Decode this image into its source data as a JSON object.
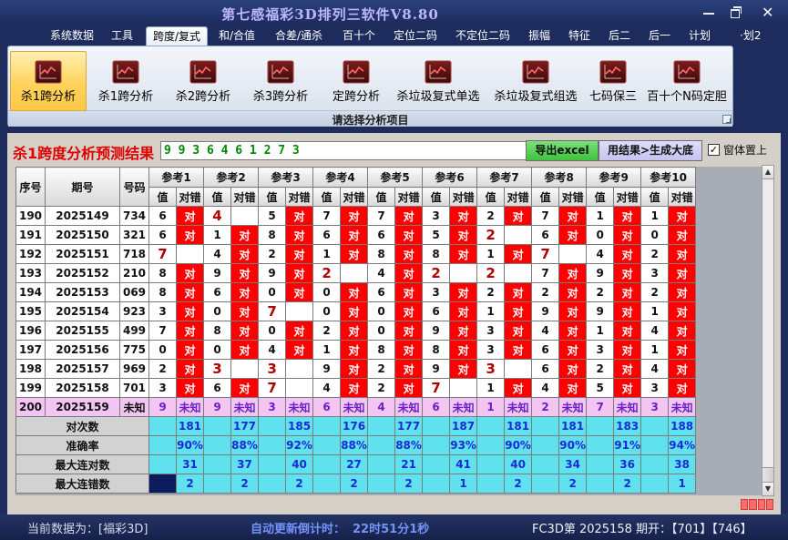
{
  "window": {
    "title": "第七感福彩3D排列三软件V8.80"
  },
  "menu": {
    "items": [
      {
        "label": "系统数据"
      },
      {
        "label": "工具"
      },
      {
        "label": "跨度/复式",
        "selected": true
      },
      {
        "label": "和/合值"
      },
      {
        "label": "合差/通杀"
      },
      {
        "label": "百十个"
      },
      {
        "label": "定位二码"
      },
      {
        "label": "不定位二码"
      },
      {
        "label": "振幅"
      },
      {
        "label": "特征"
      },
      {
        "label": "后二"
      },
      {
        "label": "后一"
      },
      {
        "label": "计划"
      },
      {
        "label": "·划2"
      }
    ]
  },
  "ribbon": {
    "icon": "chart-icon",
    "items": [
      {
        "label": "杀1跨分析",
        "selected": true
      },
      {
        "label": "杀1跨分析"
      },
      {
        "label": "杀2跨分析"
      },
      {
        "label": "杀3跨分析"
      },
      {
        "label": "定跨分析"
      },
      {
        "label": "杀垃圾复式单选"
      },
      {
        "label": "杀垃圾复式组选"
      },
      {
        "label": "七码保三"
      },
      {
        "label": "百十个N码定胆"
      }
    ],
    "group_label": "请选择分析项目"
  },
  "panel": {
    "title": "杀1跨度分析预测结果",
    "result": "9 9 3 6 4 6 1 2 7 3",
    "export_label": "导出excel",
    "generate_label": "用结果>生成大底",
    "topmost_label": "窗体置上",
    "topmost_checked": true
  },
  "grid": {
    "headers": {
      "seq": "序号",
      "period": "期号",
      "number": "号码",
      "value": "值",
      "verdict": "对错",
      "refs": [
        "参考1",
        "参考2",
        "参考3",
        "参考4",
        "参考5",
        "参考6",
        "参考7",
        "参考8",
        "参考9",
        "参考10"
      ]
    },
    "rows": [
      {
        "seq": "190",
        "period": "2025149",
        "number": "734",
        "cells": [
          [
            "6",
            "对"
          ],
          [
            "4",
            ""
          ],
          [
            "5",
            "对"
          ],
          [
            "7",
            "对"
          ],
          [
            "7",
            "对"
          ],
          [
            "3",
            "对"
          ],
          [
            "2",
            "对"
          ],
          [
            "7",
            "对"
          ],
          [
            "1",
            "对"
          ],
          [
            "1",
            "对"
          ]
        ]
      },
      {
        "seq": "191",
        "period": "2025150",
        "number": "321",
        "cells": [
          [
            "6",
            "对"
          ],
          [
            "1",
            "对"
          ],
          [
            "8",
            "对"
          ],
          [
            "6",
            "对"
          ],
          [
            "6",
            "对"
          ],
          [
            "5",
            "对"
          ],
          [
            "2",
            ""
          ],
          [
            "6",
            "对"
          ],
          [
            "0",
            "对"
          ],
          [
            "0",
            "对"
          ]
        ]
      },
      {
        "seq": "192",
        "period": "2025151",
        "number": "718",
        "cells": [
          [
            "7",
            ""
          ],
          [
            "4",
            "对"
          ],
          [
            "2",
            "对"
          ],
          [
            "1",
            "对"
          ],
          [
            "8",
            "对"
          ],
          [
            "8",
            "对"
          ],
          [
            "1",
            "对"
          ],
          [
            "7",
            ""
          ],
          [
            "4",
            "对"
          ],
          [
            "2",
            "对"
          ]
        ]
      },
      {
        "seq": "193",
        "period": "2025152",
        "number": "210",
        "cells": [
          [
            "8",
            "对"
          ],
          [
            "9",
            "对"
          ],
          [
            "9",
            "对"
          ],
          [
            "2",
            ""
          ],
          [
            "4",
            "对"
          ],
          [
            "2",
            ""
          ],
          [
            "2",
            ""
          ],
          [
            "7",
            "对"
          ],
          [
            "9",
            "对"
          ],
          [
            "3",
            "对"
          ]
        ]
      },
      {
        "seq": "194",
        "period": "2025153",
        "number": "069",
        "cells": [
          [
            "8",
            "对"
          ],
          [
            "6",
            "对"
          ],
          [
            "0",
            "对"
          ],
          [
            "0",
            "对"
          ],
          [
            "6",
            "对"
          ],
          [
            "3",
            "对"
          ],
          [
            "2",
            "对"
          ],
          [
            "2",
            "对"
          ],
          [
            "2",
            "对"
          ],
          [
            "2",
            "对"
          ]
        ]
      },
      {
        "seq": "195",
        "period": "2025154",
        "number": "923",
        "cells": [
          [
            "3",
            "对"
          ],
          [
            "0",
            "对"
          ],
          [
            "7",
            ""
          ],
          [
            "0",
            "对"
          ],
          [
            "0",
            "对"
          ],
          [
            "6",
            "对"
          ],
          [
            "1",
            "对"
          ],
          [
            "9",
            "对"
          ],
          [
            "9",
            "对"
          ],
          [
            "1",
            "对"
          ]
        ]
      },
      {
        "seq": "196",
        "period": "2025155",
        "number": "499",
        "cells": [
          [
            "7",
            "对"
          ],
          [
            "8",
            "对"
          ],
          [
            "0",
            "对"
          ],
          [
            "2",
            "对"
          ],
          [
            "0",
            "对"
          ],
          [
            "9",
            "对"
          ],
          [
            "3",
            "对"
          ],
          [
            "4",
            "对"
          ],
          [
            "1",
            "对"
          ],
          [
            "4",
            "对"
          ]
        ]
      },
      {
        "seq": "197",
        "period": "2025156",
        "number": "775",
        "cells": [
          [
            "0",
            "对"
          ],
          [
            "0",
            "对"
          ],
          [
            "4",
            "对"
          ],
          [
            "1",
            "对"
          ],
          [
            "8",
            "对"
          ],
          [
            "8",
            "对"
          ],
          [
            "3",
            "对"
          ],
          [
            "6",
            "对"
          ],
          [
            "3",
            "对"
          ],
          [
            "1",
            "对"
          ]
        ]
      },
      {
        "seq": "198",
        "period": "2025157",
        "number": "969",
        "cells": [
          [
            "2",
            "对"
          ],
          [
            "3",
            ""
          ],
          [
            "3",
            ""
          ],
          [
            "9",
            "对"
          ],
          [
            "2",
            "对"
          ],
          [
            "9",
            "对"
          ],
          [
            "3",
            ""
          ],
          [
            "6",
            "对"
          ],
          [
            "2",
            "对"
          ],
          [
            "4",
            "对"
          ]
        ]
      },
      {
        "seq": "199",
        "period": "2025158",
        "number": "701",
        "cells": [
          [
            "3",
            "对"
          ],
          [
            "6",
            "对"
          ],
          [
            "7",
            ""
          ],
          [
            "4",
            "对"
          ],
          [
            "2",
            "对"
          ],
          [
            "7",
            ""
          ],
          [
            "1",
            "对"
          ],
          [
            "4",
            "对"
          ],
          [
            "5",
            "对"
          ],
          [
            "3",
            "对"
          ]
        ]
      },
      {
        "seq": "200",
        "period": "2025159",
        "number": "未知",
        "pending": true,
        "cells": [
          [
            "9",
            "未知"
          ],
          [
            "9",
            "未知"
          ],
          [
            "3",
            "未知"
          ],
          [
            "6",
            "未知"
          ],
          [
            "4",
            "未知"
          ],
          [
            "6",
            "未知"
          ],
          [
            "1",
            "未知"
          ],
          [
            "2",
            "未知"
          ],
          [
            "7",
            "未知"
          ],
          [
            "3",
            "未知"
          ]
        ]
      }
    ],
    "summary": [
      {
        "label": "对次数",
        "values": [
          "181",
          "177",
          "185",
          "176",
          "177",
          "187",
          "181",
          "181",
          "183",
          "188"
        ]
      },
      {
        "label": "准确率",
        "values": [
          "90%",
          "88%",
          "92%",
          "88%",
          "88%",
          "93%",
          "90%",
          "90%",
          "91%",
          "94%"
        ]
      },
      {
        "label": "最大连对数",
        "values": [
          "31",
          "37",
          "40",
          "27",
          "21",
          "41",
          "40",
          "34",
          "36",
          "38"
        ]
      },
      {
        "label": "最大连错数",
        "values": [
          "2",
          "2",
          "2",
          "2",
          "2",
          "1",
          "2",
          "2",
          "2",
          "1"
        ]
      }
    ],
    "selection": {
      "summary_row": 3,
      "ref": 0
    }
  },
  "status": {
    "source": "当前数据为：[福彩3D]",
    "countdown_label": "自动更新倒计时：",
    "countdown_value": "22时51分1秒",
    "draw": "FC3D第 2025158 期开：【701】【746】"
  },
  "colors": {
    "title_red": "#e00000",
    "hit": "#ff0000",
    "miss_value": "#b00000",
    "result_text": "#008a00",
    "summary_bg": "#5fe2ee",
    "pending_row": "#f2c5f2",
    "countdown": "#7393ff"
  }
}
